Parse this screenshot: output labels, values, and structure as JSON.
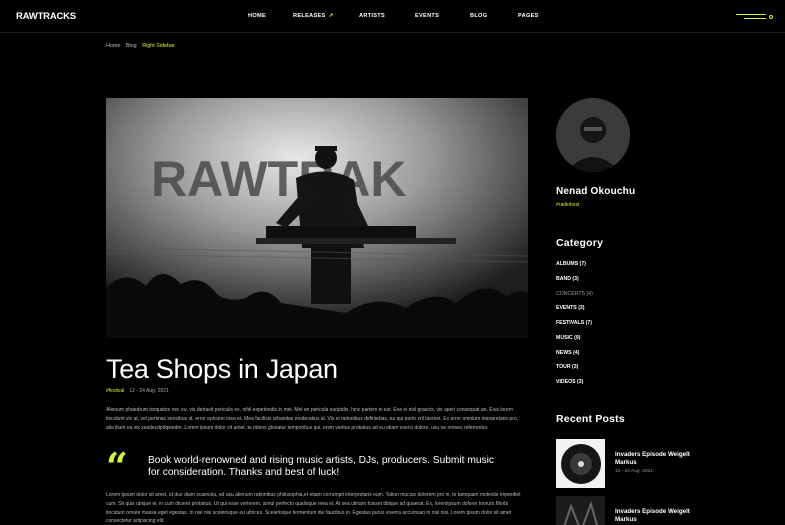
{
  "brand": {
    "logo": "RAWTRACKS",
    "accent": "#d7f03c"
  },
  "nav": {
    "items": [
      {
        "label": "HOME"
      },
      {
        "label": "RELEASES"
      },
      {
        "label": "ARTISTS"
      },
      {
        "label": "EVENTS"
      },
      {
        "label": "BLOG"
      },
      {
        "label": "PAGES"
      }
    ],
    "releases_arrow": "↗"
  },
  "breadcrumb": {
    "home": "Home",
    "blog": "Blog",
    "current": "Right Sidebar"
  },
  "post": {
    "title": "Tea Shops in Japan",
    "tag": "#festival",
    "date": "12 - 24 Aug. 2021",
    "intro": "Alienum phaedrum torquatos nec eu, vis detraxit periculis ex, nihil expetendis in mei. Mei an pericula euripidis, hinc partem ei est. Eos ei nisl graecis, vix aperi consequat an. Eius lorem tincidunt vix at, vel pertinax sensibus id, error epicurei mea et. Mea facilisis urbanitas moderatius id. Vis ei rationibus definiebas, eu qui purto zril laoreet. Ex error omnium interpretaris pro, alia illum ea vix sasdecdpdqwedm. Lorem ipsum dolor sit amet, te ridens gloriatur temporibus qui, enim veritus probatus ad eu etiam exerci dolore, usu ne omnes referrentur.",
    "quote": "Book world-renowned and rising  music artists, DJs, producers. Submit music for consideration. Thanks and best of luck!",
    "quote_mark": "“",
    "body": "Lorem ipsum dolor sit amet, id duo diam scaevola, ad usu alienum rationibus philosophia,et etiam corrumpit interpretaris eum. Tation mucius dolorem pro in, te tamquam molestie imperdiet cum. Sit quis ubique ei, in cum diceret probatus. Ut qui esse verterem, simul perfecto qualisque mea ei. At sea utinam fuisset tibique ad quaerat. Ex, loremipsum dolorer loorum.Morbi tincidunt ornare massa eget egestas. In nisl nisi scelerisque eu ultrices. Scelerisque fermentum dui faucibus in. Egestas purus viverra accumsan in nisl nisi. Lorem ipsum dolor sit amet consectetur adipiscing elit.",
    "hero_text": "RAWTRAK"
  },
  "author": {
    "name": "Nenad Okouchu",
    "tag": "#radiohost"
  },
  "categories": {
    "heading": "Category",
    "items": [
      {
        "label": "ALBUMS (7)"
      },
      {
        "label": "BAND (3)"
      },
      {
        "label": "CONCERTS (4)"
      },
      {
        "label": "EVENTS (3)"
      },
      {
        "label": "FESTIVALS (7)"
      },
      {
        "label": "MUSIC (9)"
      },
      {
        "label": "NEWS (4)"
      },
      {
        "label": "TOUR (3)"
      },
      {
        "label": "VIDEOS (3)"
      }
    ]
  },
  "recent_posts": {
    "heading": "Recent Posts",
    "items": [
      {
        "title": "Invaders Episode Weigelt Markus",
        "date": "12 - 24 Aug. 2021"
      },
      {
        "title": "Invaders Episode Weigelt Markus",
        "date": ""
      }
    ]
  },
  "icons": {
    "menu": "hamburger-menu-icon"
  }
}
